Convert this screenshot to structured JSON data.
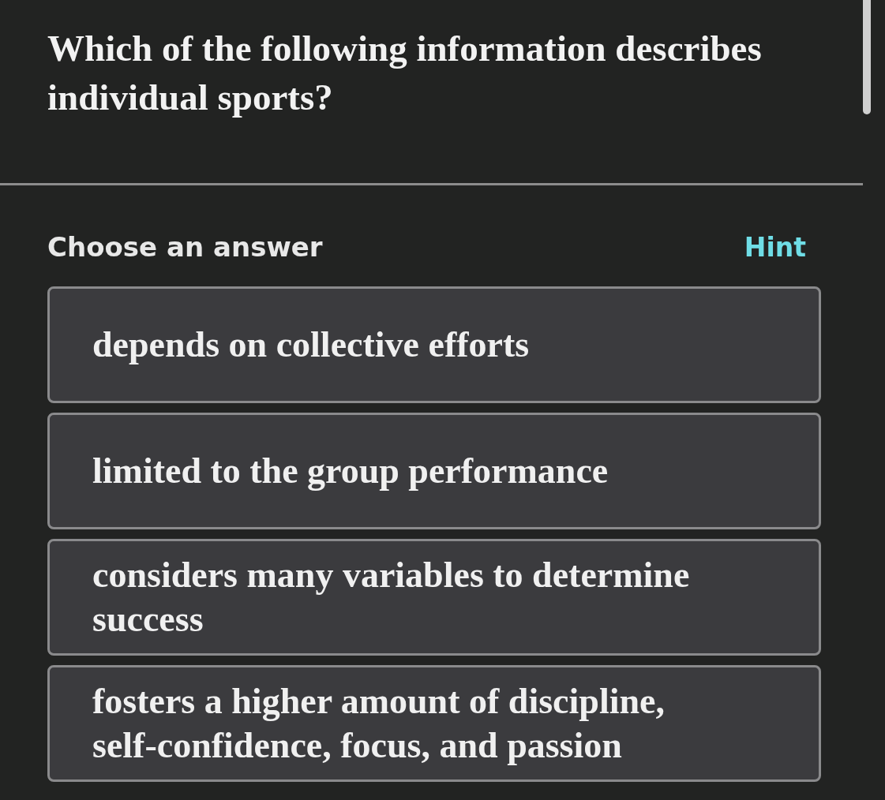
{
  "question": {
    "text": "Which of the following information describes individual sports?"
  },
  "answer_header": {
    "label": "Choose an answer",
    "hint": "Hint"
  },
  "options": [
    {
      "text": "depends on collective efforts",
      "selected": false
    },
    {
      "text": "limited to the group performance",
      "selected": false
    },
    {
      "text": "considers many variables to determine success",
      "selected": false
    },
    {
      "text": "fosters a higher amount of discipline, self-confidence, focus, and passion",
      "selected": false
    }
  ]
}
